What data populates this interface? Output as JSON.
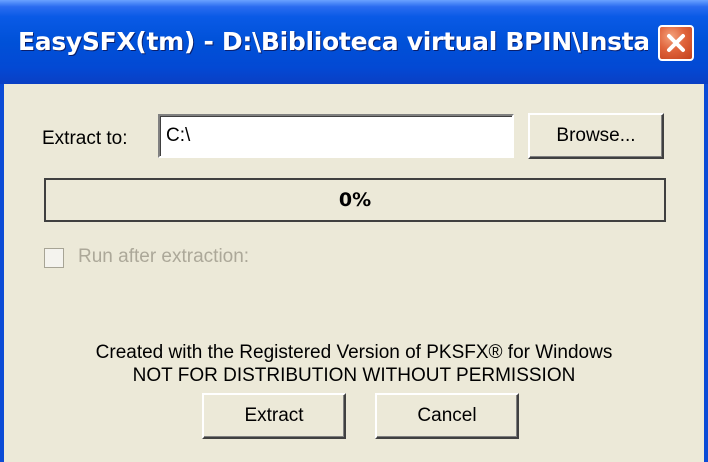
{
  "window": {
    "title": "EasySFX(tm) - D:\\Biblioteca virtual BPIN\\Instalado...",
    "close_icon": "close-icon"
  },
  "extract": {
    "label": "Extract to:",
    "path_value": "C:\\",
    "browse_label": "Browse..."
  },
  "progress": {
    "text": "0%",
    "fraction": 0
  },
  "run_after": {
    "label": "Run after extraction:",
    "checked": false,
    "enabled": false
  },
  "footer": {
    "line1": "Created with the Registered Version of PKSFX® for Windows",
    "line2": "NOT FOR DISTRIBUTION WITHOUT PERMISSION"
  },
  "buttons": {
    "extract_label": "Extract",
    "cancel_label": "Cancel"
  },
  "colors": {
    "titlebar": "#0051d8",
    "dialog_bg": "#ece9d8",
    "close_button": "#e0643c",
    "disabled_text": "#aca899"
  }
}
